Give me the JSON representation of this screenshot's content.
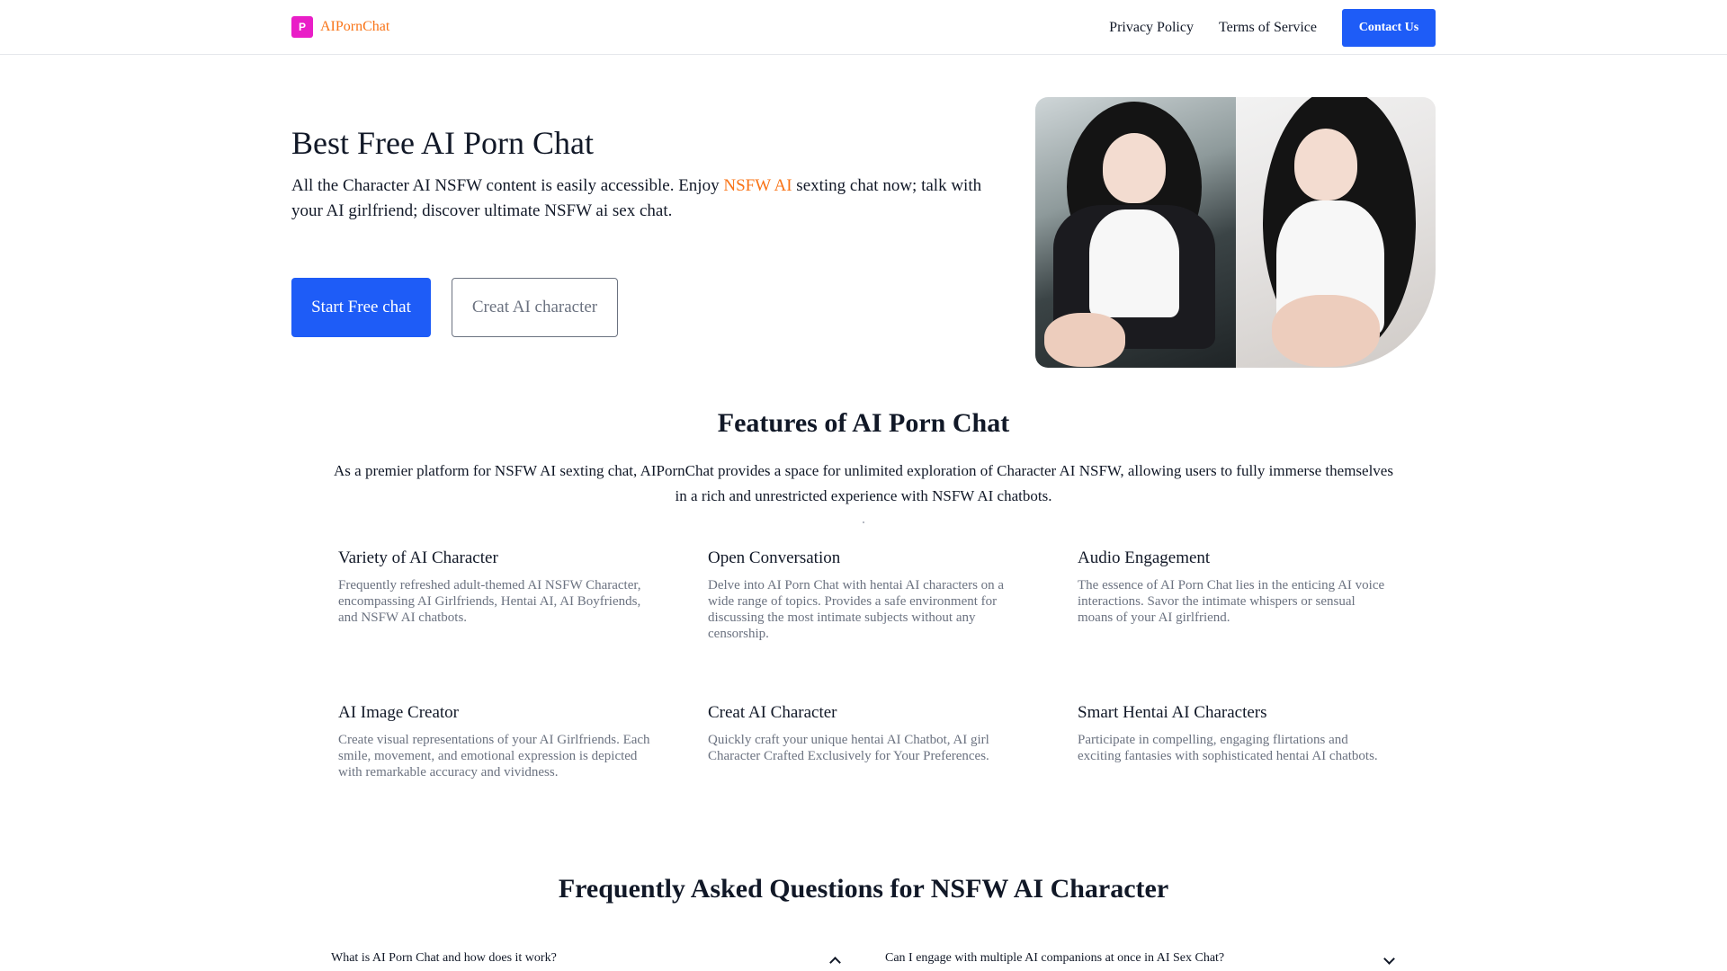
{
  "header": {
    "logo_mark": "P",
    "logo_text": "AIPornChat",
    "nav": [
      "Privacy Policy",
      "Terms of Service"
    ],
    "contact_label": "Contact Us"
  },
  "hero": {
    "title": "Best Free AI Porn Chat",
    "desc_before": "All the Character AI NSFW content is easily accessible. Enjoy ",
    "desc_link": "NSFW AI",
    "desc_after": " sexting chat now; talk with your AI girlfriend; discover ultimate NSFW ai sex chat.",
    "primary_button": "Start Free chat",
    "secondary_button": "Creat AI character"
  },
  "features": {
    "title": "Features of AI Porn Chat",
    "description": "As a premier platform for NSFW AI sexting chat, AIPornChat provides a space for unlimited exploration of Character AI NSFW, allowing users to fully immerse themselves in a rich and unrestricted experience with NSFW AI chatbots.",
    "items": [
      {
        "title": "Variety of AI Character",
        "text": "Frequently refreshed adult-themed AI NSFW Character, encompassing AI Girlfriends, Hentai AI, AI Boyfriends, and NSFW AI chatbots."
      },
      {
        "title": "Open Conversation",
        "text": "Delve into AI Porn Chat with hentai AI characters on a wide range of topics. Provides a safe environment for discussing the most intimate subjects without any censorship."
      },
      {
        "title": "Audio Engagement",
        "text": "The essence of AI Porn Chat lies in the enticing AI voice interactions. Savor the intimate whispers or sensual moans of your AI girlfriend."
      },
      {
        "title": "AI Image Creator",
        "text": "Create visual representations of your AI Girlfriends. Each smile, movement, and emotional expression is depicted with remarkable accuracy and vividness."
      },
      {
        "title": "Creat AI Character",
        "text": "Quickly craft your unique hentai AI Chatbot, AI girl Character Crafted Exclusively for Your Preferences."
      },
      {
        "title": "Smart Hentai AI Characters",
        "text": "Participate in compelling, engaging flirtations and exciting fantasies with sophisticated hentai AI chatbots."
      }
    ]
  },
  "faq": {
    "title": "Frequently Asked Questions for NSFW AI Character",
    "questions": [
      "What is AI Porn Chat and how does it work?",
      "Can I engage with multiple AI companions at once in AI Sex Chat?"
    ]
  },
  "colors": {
    "accent": "#f97316",
    "primary": "#1e5cf7",
    "logo_bg": "#e91ec7"
  }
}
